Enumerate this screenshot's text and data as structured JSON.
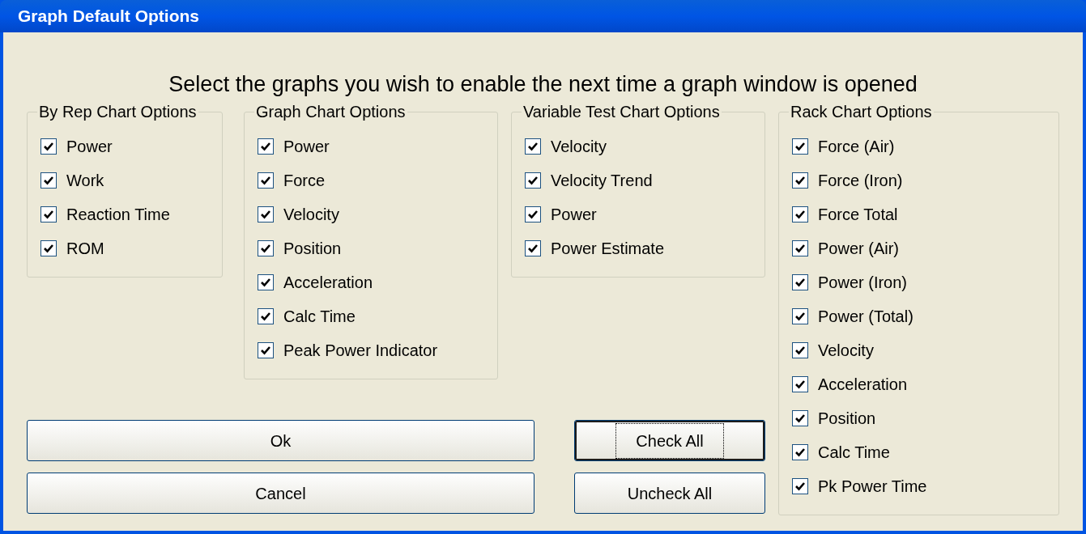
{
  "window": {
    "title": "Graph Default Options"
  },
  "heading": "Select the graphs you wish to enable the next time a graph window is opened",
  "groups": [
    {
      "title": "By Rep Chart Options",
      "options": [
        {
          "label": "Power",
          "checked": true
        },
        {
          "label": "Work",
          "checked": true
        },
        {
          "label": "Reaction Time",
          "checked": true
        },
        {
          "label": "ROM",
          "checked": true
        }
      ]
    },
    {
      "title": "Graph Chart Options",
      "options": [
        {
          "label": "Power",
          "checked": true
        },
        {
          "label": "Force",
          "checked": true
        },
        {
          "label": "Velocity",
          "checked": true
        },
        {
          "label": "Position",
          "checked": true
        },
        {
          "label": "Acceleration",
          "checked": true
        },
        {
          "label": "Calc Time",
          "checked": true
        },
        {
          "label": "Peak Power Indicator",
          "checked": true
        }
      ]
    },
    {
      "title": "Variable Test Chart Options",
      "options": [
        {
          "label": "Velocity",
          "checked": true
        },
        {
          "label": "Velocity Trend",
          "checked": true
        },
        {
          "label": "Power",
          "checked": true
        },
        {
          "label": "Power Estimate",
          "checked": true
        }
      ]
    },
    {
      "title": "Rack Chart Options",
      "options": [
        {
          "label": "Force (Air)",
          "checked": true
        },
        {
          "label": "Force (Iron)",
          "checked": true
        },
        {
          "label": "Force Total",
          "checked": true
        },
        {
          "label": "Power (Air)",
          "checked": true
        },
        {
          "label": "Power (Iron)",
          "checked": true
        },
        {
          "label": "Power (Total)",
          "checked": true
        },
        {
          "label": "Velocity",
          "checked": true
        },
        {
          "label": "Acceleration",
          "checked": true
        },
        {
          "label": "Position",
          "checked": true
        },
        {
          "label": "Calc Time",
          "checked": true
        },
        {
          "label": "Pk Power Time",
          "checked": true
        }
      ]
    }
  ],
  "buttons": [
    {
      "label": "Ok",
      "focused": false
    },
    {
      "label": "Check All",
      "focused": true
    },
    {
      "label": "Cancel",
      "focused": false
    },
    {
      "label": "Uncheck All",
      "focused": false
    }
  ]
}
